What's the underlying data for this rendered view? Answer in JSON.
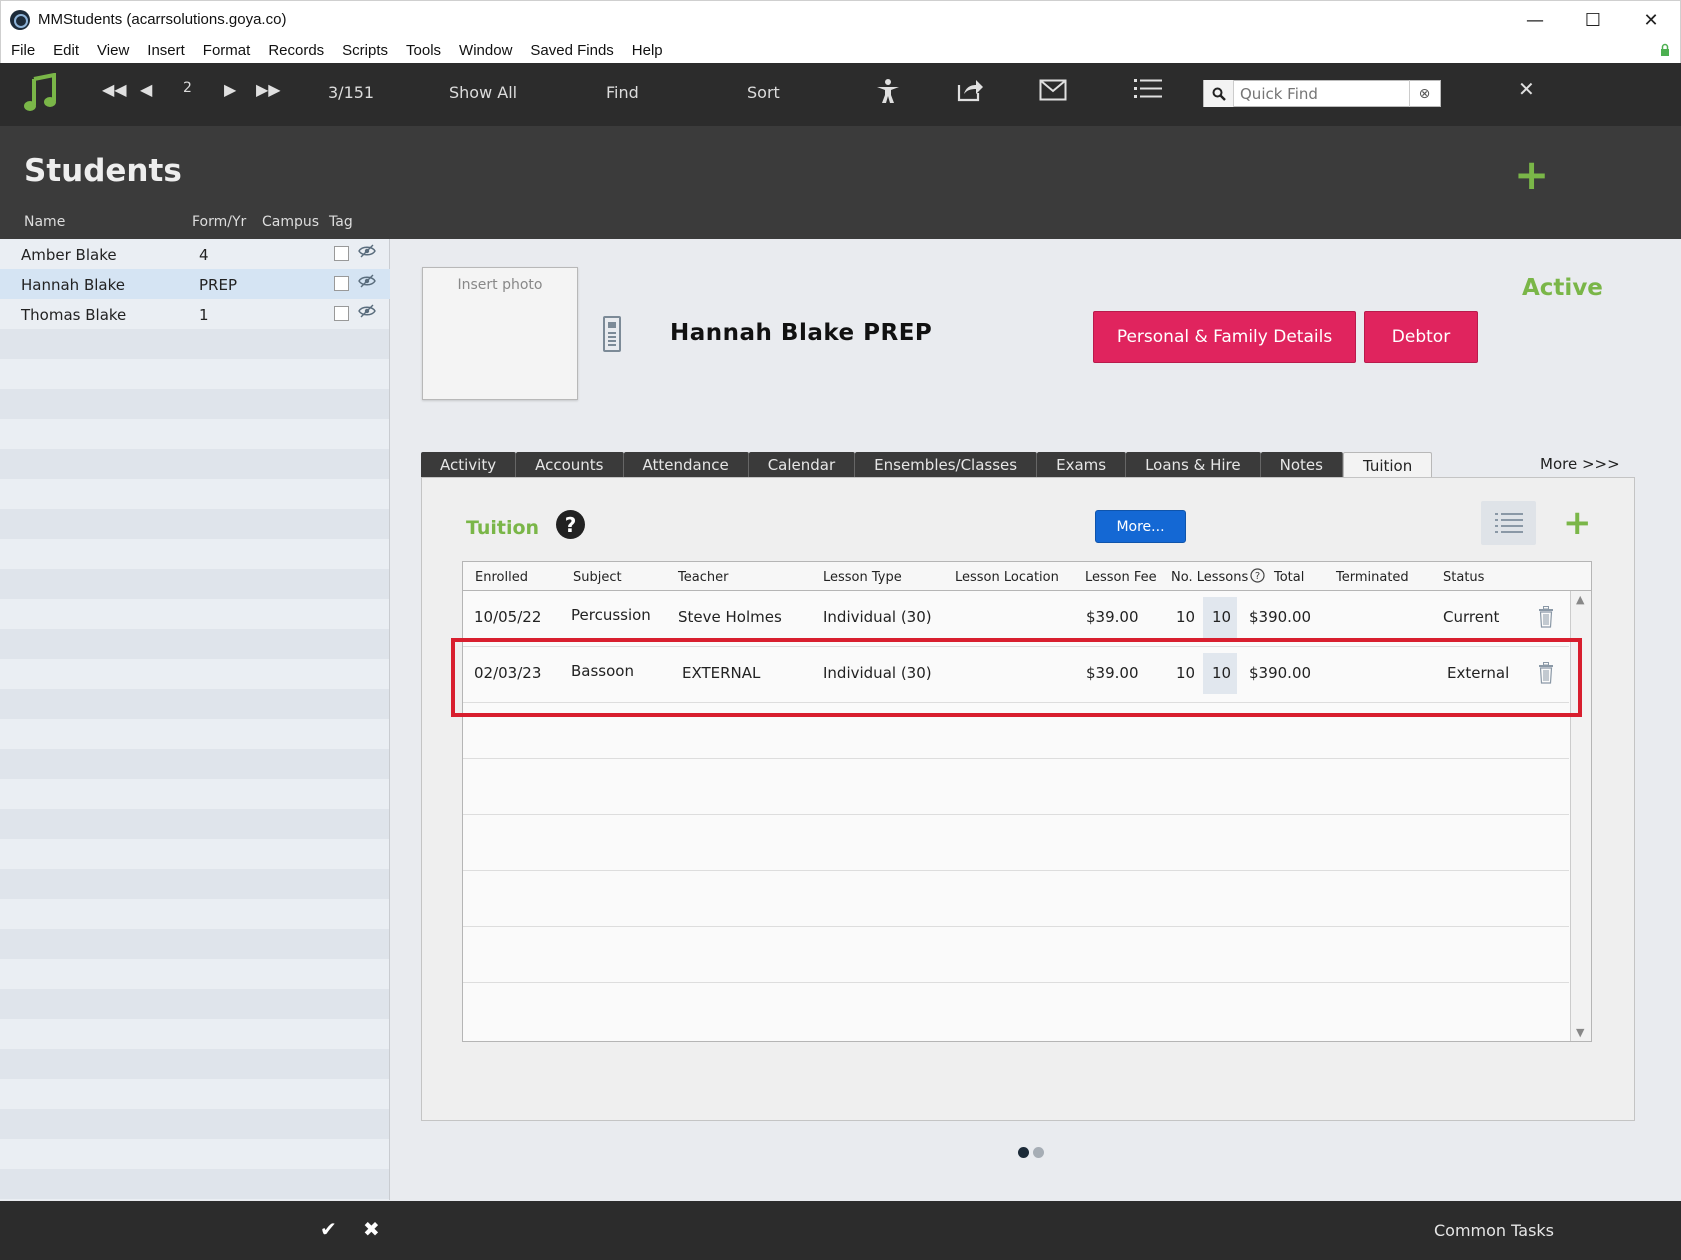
{
  "window": {
    "title": "MMStudents (acarrsolutions.goya.co)"
  },
  "menu": [
    "File",
    "Edit",
    "View",
    "Insert",
    "Format",
    "Records",
    "Scripts",
    "Tools",
    "Window",
    "Saved Finds",
    "Help"
  ],
  "toolbar": {
    "record_number": "2",
    "record_count": "3/151",
    "show_all": "Show All",
    "find": "Find",
    "sort": "Sort",
    "quick_find_placeholder": "Quick Find"
  },
  "header": {
    "title": "Students",
    "columns": {
      "name": "Name",
      "form": "Form/Yr",
      "campus": "Campus",
      "tag": "Tag"
    }
  },
  "students": [
    {
      "name": "Amber Blake",
      "form": "4",
      "selected": false
    },
    {
      "name": "Hannah Blake",
      "form": "PREP",
      "selected": true
    },
    {
      "name": "Thomas Blake",
      "form": "1",
      "selected": false
    }
  ],
  "detail": {
    "photo_placeholder": "Insert photo",
    "student_heading": "Hannah Blake  PREP",
    "status": "Active",
    "personal_family_button": "Personal & Family Details",
    "debtor_button": "Debtor"
  },
  "tabs": [
    "Activity",
    "Accounts",
    "Attendance",
    "Calendar",
    "Ensembles/Classes",
    "Exams",
    "Loans & Hire",
    "Notes",
    "Tuition"
  ],
  "active_tab": "Tuition",
  "more_tabs_label": "More >>>",
  "tuition": {
    "label": "Tuition",
    "help_icon": "?",
    "more_button": "More...",
    "columns": {
      "enrolled": "Enrolled",
      "subject": "Subject",
      "teacher": "Teacher",
      "lesson_type": "Lesson Type",
      "lesson_location": "Lesson Location",
      "lesson_fee": "Lesson Fee",
      "no_lessons": "No. Lessons",
      "total": "Total",
      "terminated": "Terminated",
      "status": "Status"
    },
    "rows": [
      {
        "enrolled": "10/05/22",
        "subject": "Percussion",
        "teacher": "Steve Holmes",
        "lesson_type": "Individual (30)",
        "lesson_location": "",
        "lesson_fee": "$39.00",
        "no_lessons": "10",
        "no_lessons_box": "10",
        "total": "$390.00",
        "terminated": "",
        "status": "Current"
      },
      {
        "enrolled": "02/03/23",
        "subject": "Bassoon",
        "teacher": "EXTERNAL",
        "lesson_type": "Individual (30)",
        "lesson_location": "",
        "lesson_fee": "$39.00",
        "no_lessons": "10",
        "no_lessons_box": "10",
        "total": "$390.00",
        "terminated": "",
        "status": "External"
      }
    ]
  },
  "bottom": {
    "common_tasks": "Common Tasks"
  },
  "colors": {
    "accent_green": "#7ab648",
    "button_pink": "#e0245e",
    "button_blue": "#1468d4",
    "highlight_red": "#d81e2e"
  }
}
